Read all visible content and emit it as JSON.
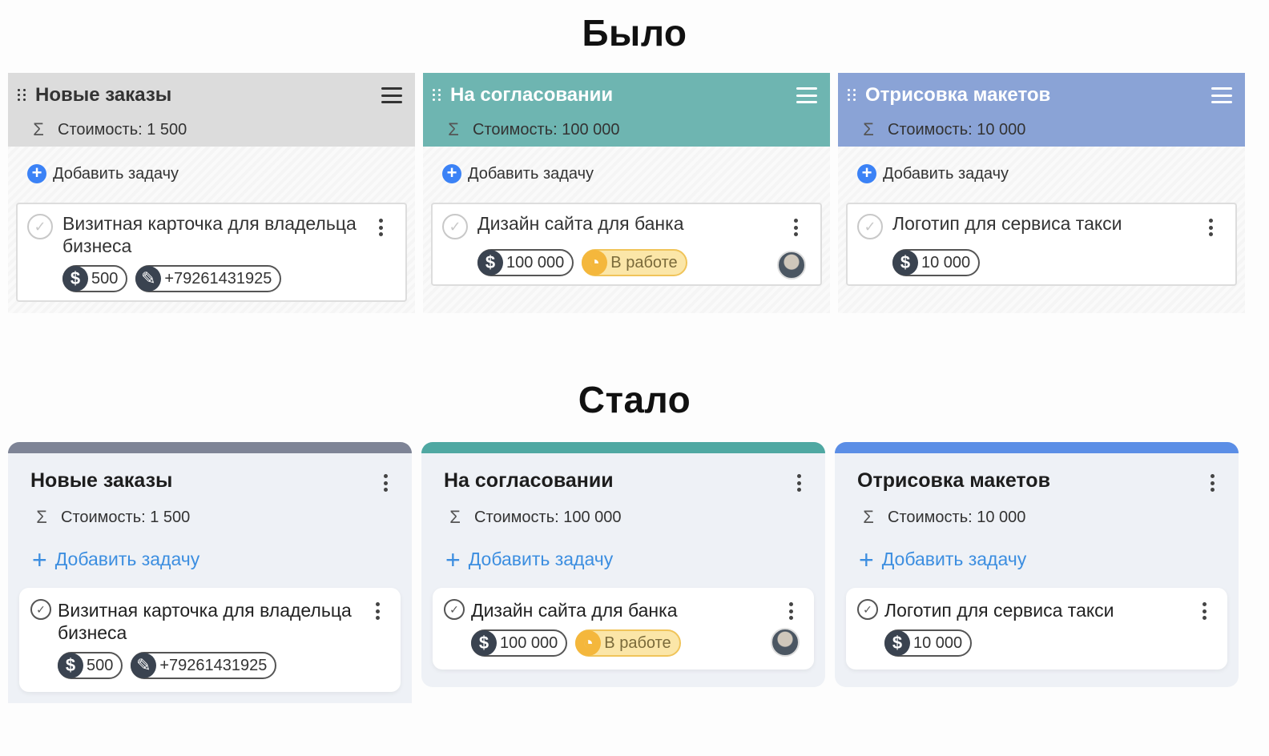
{
  "before": {
    "heading": "Было",
    "columns": [
      {
        "title": "Новые заказы",
        "sum_label": "Стоимость: 1 500",
        "add_label": "Добавить задачу",
        "color": "#dcdcdc",
        "text_color": "#333333",
        "card": {
          "title": "Визитная карточка для владельца бизнеса",
          "price": "500",
          "phone": "+79261431925"
        }
      },
      {
        "title": "На согласовании",
        "sum_label": "Стоимость: 100 000",
        "add_label": "Добавить задачу",
        "color": "#6eb5b1",
        "text_color": "#ffffff",
        "card": {
          "title": "Дизайн сайта для банка",
          "price": "100 000",
          "status": "В работе"
        }
      },
      {
        "title": "Отрисовка макетов",
        "sum_label": "Стоимость: 10 000",
        "add_label": "Добавить задачу",
        "color": "#8aa3d6",
        "text_color": "#ffffff",
        "card": {
          "title": "Логотип для сервиса такси",
          "price": "10 000"
        }
      }
    ]
  },
  "after": {
    "heading": "Стало",
    "columns": [
      {
        "title": "Новые заказы",
        "sum_label": "Стоимость: 1 500",
        "add_label": "Добавить задачу",
        "accent": "#7e8496",
        "card": {
          "title": "Визитная карточка для владельца бизнеса",
          "price": "500",
          "phone": "+79261431925"
        }
      },
      {
        "title": "На согласовании",
        "sum_label": "Стоимость: 100 000",
        "add_label": "Добавить задачу",
        "accent": "#4fa8a2",
        "card": {
          "title": "Дизайн сайта для банка",
          "price": "100 000",
          "status": "В работе"
        }
      },
      {
        "title": "Отрисовка макетов",
        "sum_label": "Стоимость: 10 000",
        "add_label": "Добавить задачу",
        "accent": "#5b8ee6",
        "card": {
          "title": "Логотип для сервиса такси",
          "price": "10 000"
        }
      }
    ]
  },
  "icons": {
    "sum": "sigma-icon",
    "add": "plus-icon",
    "menu": "hamburger-icon",
    "more": "kebab-icon",
    "money": "dollar-icon",
    "pin": "pin-icon",
    "status": "clock-icon",
    "check": "check-icon",
    "drag": "drag-handle-icon"
  }
}
